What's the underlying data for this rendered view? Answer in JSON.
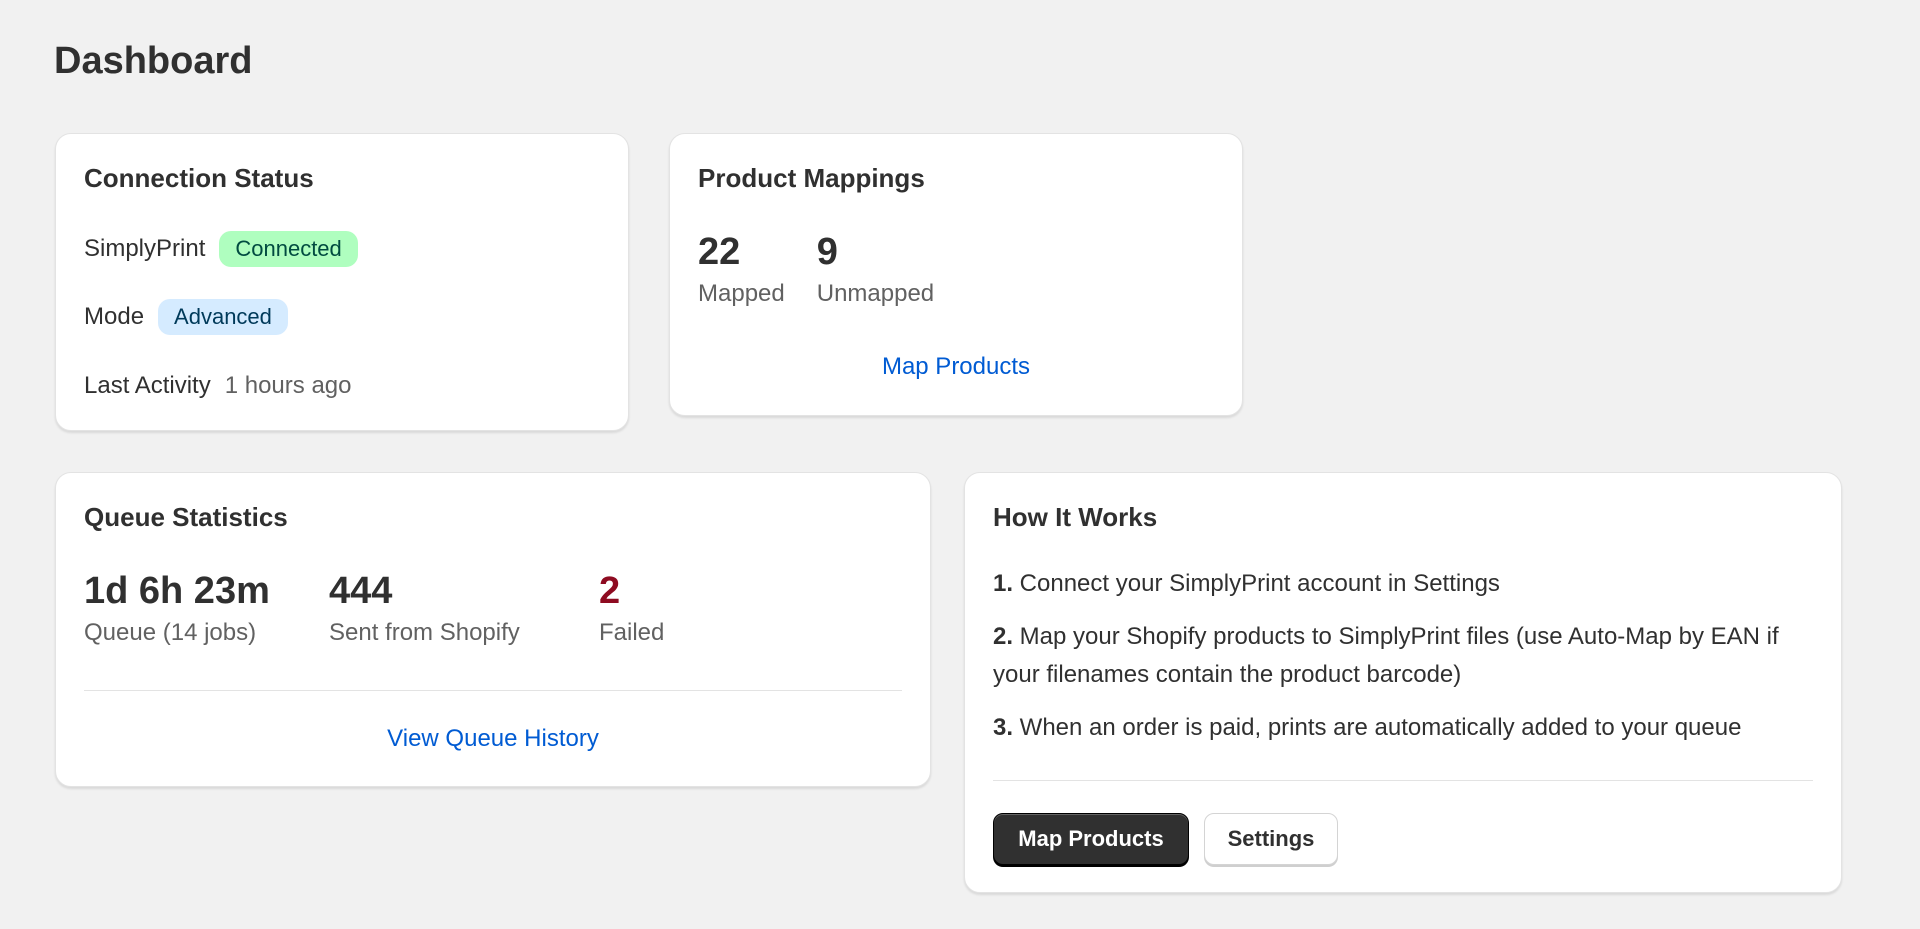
{
  "page": {
    "title": "Dashboard"
  },
  "connection": {
    "title": "Connection Status",
    "service_label": "SimplyPrint",
    "service_status": "Connected",
    "mode_label": "Mode",
    "mode_value": "Advanced",
    "activity_label": "Last Activity",
    "activity_value": "1 hours ago"
  },
  "mappings": {
    "title": "Product Mappings",
    "mapped_count": "22",
    "mapped_label": "Mapped",
    "unmapped_count": "9",
    "unmapped_label": "Unmapped",
    "link_label": "Map Products"
  },
  "queue": {
    "title": "Queue Statistics",
    "duration_value": "1d 6h 23m",
    "duration_label": "Queue (14 jobs)",
    "sent_value": "444",
    "sent_label": "Sent from Shopify",
    "failed_value": "2",
    "failed_label": "Failed",
    "link_label": "View Queue History"
  },
  "how": {
    "title": "How It Works",
    "steps": [
      {
        "num": "1.",
        "text": " Connect your SimplyPrint account in Settings"
      },
      {
        "num": "2.",
        "text": " Map your Shopify products to SimplyPrint files (use Auto-Map by EAN if your filenames contain the product barcode)"
      },
      {
        "num": "3.",
        "text": " When an order is paid, prints are automatically added to your queue"
      }
    ],
    "primary_button": "Map Products",
    "secondary_button": "Settings"
  },
  "colors": {
    "background": "#f1f1f1",
    "success_badge": "#affebf",
    "info_badge": "#d5ebff",
    "link": "#005bd3",
    "critical": "#8e0b21",
    "primary_button": "#303030"
  }
}
